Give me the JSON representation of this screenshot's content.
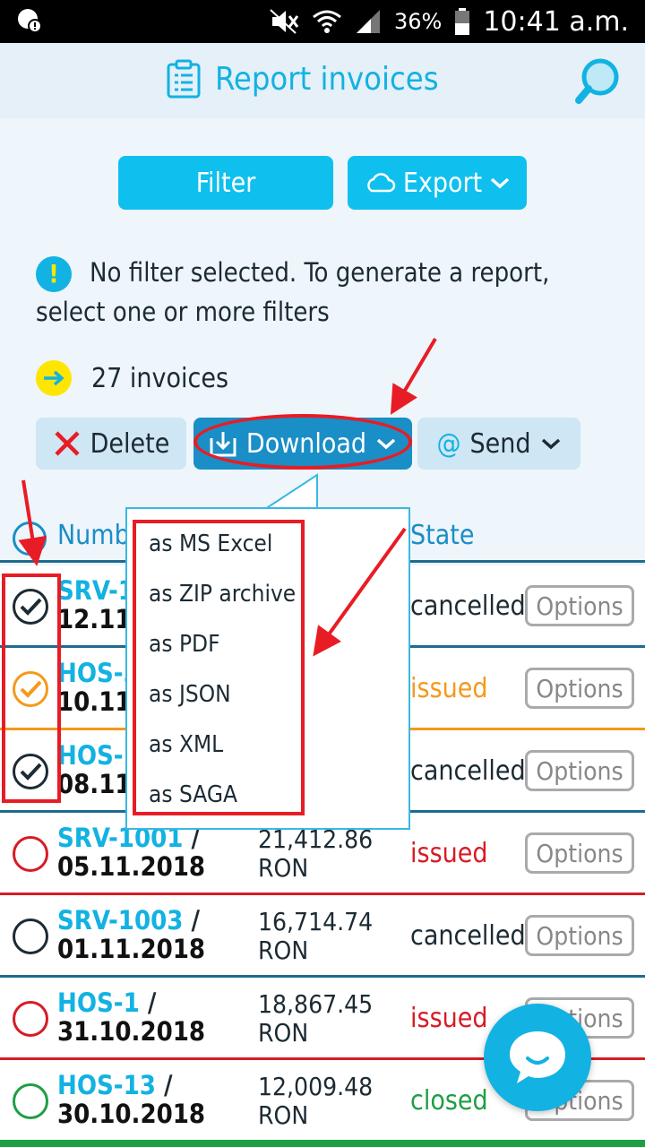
{
  "status_bar": {
    "battery": "36%",
    "time": "10:41 a.m."
  },
  "header": {
    "title": "Report invoices"
  },
  "buttons": {
    "filter": "Filter",
    "export": "Export"
  },
  "info": {
    "message": "No filter selected. To generate a report, select one or more filters"
  },
  "count": {
    "label": "27 invoices"
  },
  "actions": {
    "delete": "Delete",
    "download": "Download",
    "send": "Send"
  },
  "table": {
    "col_number": "Number",
    "col_state": "State",
    "options_label": "Options",
    "rows": [
      {
        "code": "SRV-1",
        "date": "12.11.2",
        "amount": "",
        "currency": "",
        "state": "cancelled",
        "state_color": "#1c2a33",
        "checked": true,
        "radio_color": "#1c2a33",
        "border": "#1e6b8f"
      },
      {
        "code": "HOS-3",
        "date": "10.11.2",
        "amount": "",
        "currency": "",
        "state": "issued",
        "state_color": "#f49a1a",
        "checked": true,
        "radio_color": "#f49a1a",
        "border": "#f49a1a"
      },
      {
        "code": "HOS-1",
        "date": "08.11.",
        "amount": "",
        "currency": "",
        "state": "cancelled",
        "state_color": "#1c2a33",
        "checked": true,
        "radio_color": "#1c2a33",
        "border": "#1e6b8f"
      },
      {
        "code": "SRV-1001",
        "date": "05.11.2018",
        "amount": "21,412.86",
        "currency": "RON",
        "state": "issued",
        "state_color": "#d81b26",
        "checked": false,
        "radio_color": "#d81b26",
        "border": "#d81b26"
      },
      {
        "code": "SRV-1003",
        "date": "01.11.2018",
        "amount": "16,714.74",
        "currency": "RON",
        "state": "cancelled",
        "state_color": "#1c2a33",
        "checked": false,
        "radio_color": "#1c2a33",
        "border": "#1e6b8f"
      },
      {
        "code": "HOS-1",
        "date": "31.10.2018",
        "amount": "18,867.45",
        "currency": "RON",
        "state": "issued",
        "state_color": "#d81b26",
        "checked": false,
        "radio_color": "#d81b26",
        "border": "#d81b26"
      },
      {
        "code": "HOS-13",
        "date": "30.10.2018",
        "amount": "12,009.48",
        "currency": "RON",
        "state": "closed",
        "state_color": "#1f9e45",
        "checked": false,
        "radio_color": "#1f9e45",
        "border": "#1f9e45"
      }
    ]
  },
  "download_menu": {
    "items": [
      "as MS Excel",
      "as ZIP archive",
      "as PDF",
      "as JSON",
      "as XML",
      "as SAGA"
    ]
  },
  "colors": {
    "accent": "#12b2e2",
    "primary_button": "#0fc0ee",
    "download_button": "#1a8ec6",
    "annotation": "#e81c24"
  }
}
